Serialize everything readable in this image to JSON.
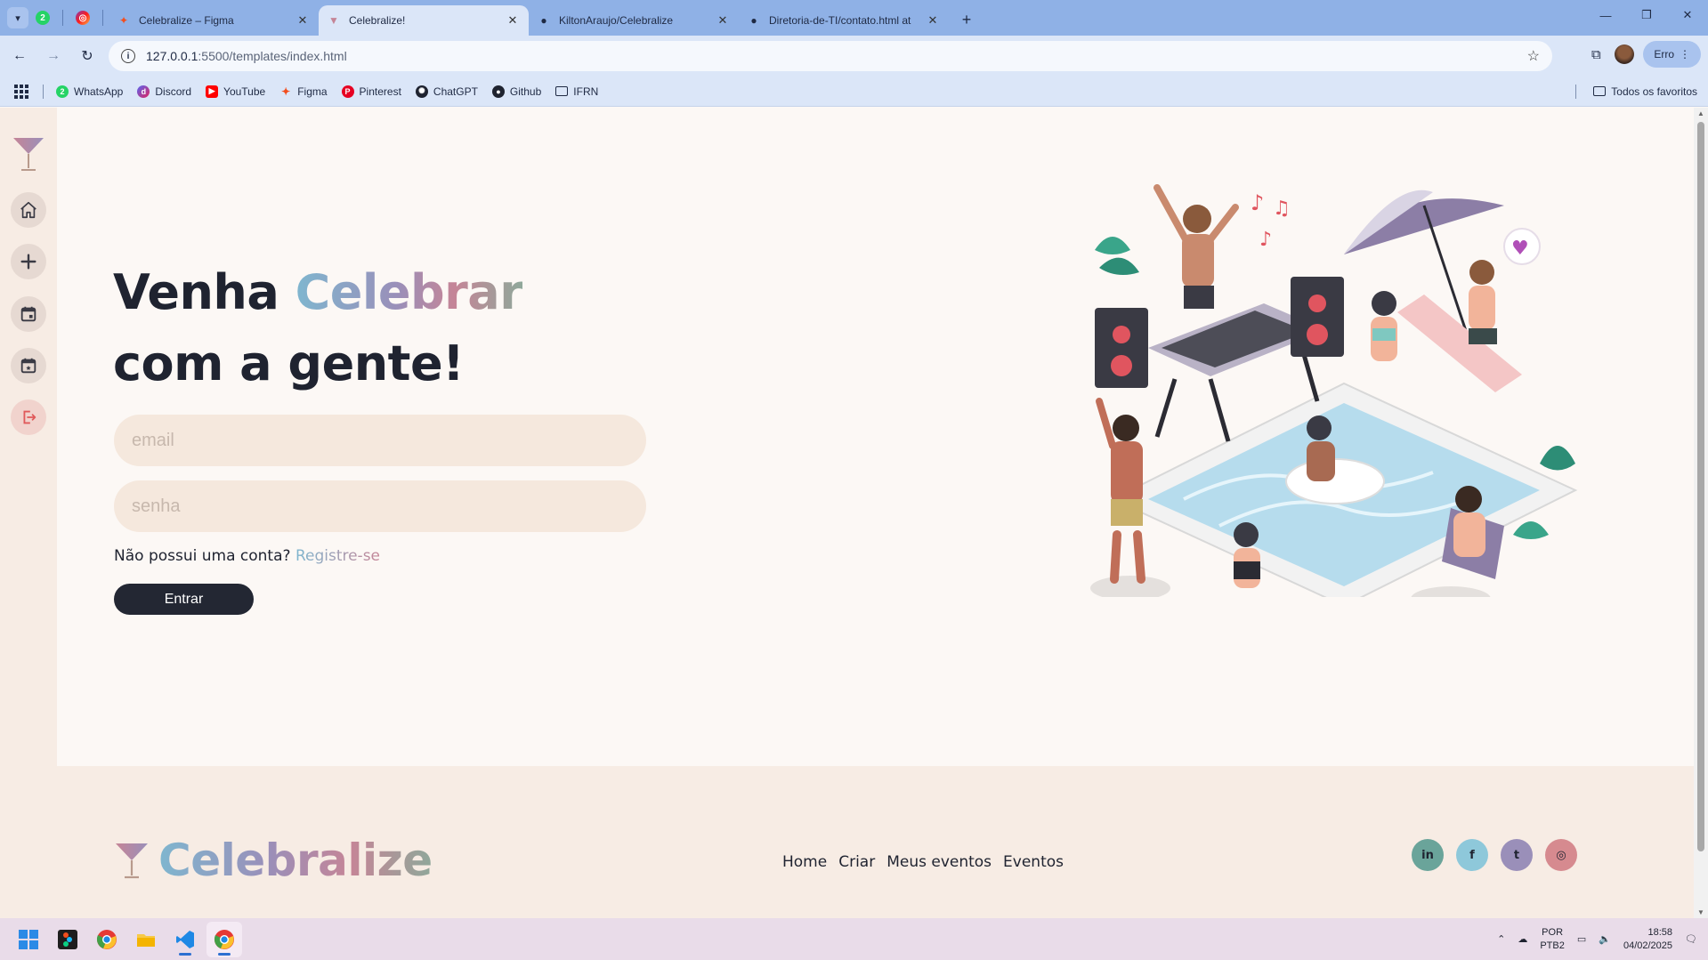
{
  "browser": {
    "tabs": [
      {
        "label": "Celebralize – Figma",
        "active": false,
        "favicon": "figma-icon"
      },
      {
        "label": "Celebralize!",
        "active": true,
        "favicon": "celebralize-icon"
      },
      {
        "label": "KiltonAraujo/Celebralize",
        "active": false,
        "favicon": "github-icon"
      },
      {
        "label": "Diretoria-de-TI/contato.html at",
        "active": false,
        "favicon": "github-icon"
      }
    ],
    "url_host": "127.0.0.1",
    "url_path": ":5500/templates/index.html",
    "error_label": "Erro",
    "bookmarks": [
      {
        "label": "WhatsApp",
        "icon": "whatsapp-icon",
        "color": "#25d366"
      },
      {
        "label": "Discord",
        "icon": "discord-icon",
        "color": "#5865f2"
      },
      {
        "label": "YouTube",
        "icon": "youtube-icon",
        "color": "#ff0000"
      },
      {
        "label": "Figma",
        "icon": "figma-icon",
        "color": "#f24e1e"
      },
      {
        "label": "Pinterest",
        "icon": "pinterest-icon",
        "color": "#e60023"
      },
      {
        "label": "ChatGPT",
        "icon": "chatgpt-icon",
        "color": "#1f2330"
      },
      {
        "label": "Github",
        "icon": "github-icon",
        "color": "#1f2330"
      },
      {
        "label": "IFRN",
        "icon": "folder-icon",
        "color": "#1f2330"
      }
    ],
    "all_bookmarks_label": "Todos os favoritos"
  },
  "page": {
    "hero_line1_prefix": "Venha ",
    "hero_line1_accent": "Celebrar",
    "hero_line2": "com a gente!",
    "email_placeholder": "email",
    "password_placeholder": "senha",
    "register_prompt": "Não possui uma conta? ",
    "register_link": "Registre-se",
    "submit_label": "Entrar",
    "sidebar_items": [
      "home-icon",
      "plus-icon",
      "calendar-icon",
      "calendar-check-icon",
      "logout-icon"
    ]
  },
  "footer": {
    "brand": "Celebralize",
    "nav": [
      "Home",
      "Criar",
      "Meus eventos",
      "Eventos"
    ],
    "socials": [
      {
        "name": "linkedin-icon",
        "glyph": "in",
        "color": "#6aa49a"
      },
      {
        "name": "facebook-icon",
        "glyph": "f",
        "color": "#8ec8da"
      },
      {
        "name": "twitter-icon",
        "glyph": "t",
        "color": "#9a8fb9"
      },
      {
        "name": "instagram-icon",
        "glyph": "◎",
        "color": "#d68a8f"
      }
    ]
  },
  "taskbar": {
    "lang_line1": "POR",
    "lang_line2": "PTB2",
    "time": "18:58",
    "date": "04/02/2025"
  },
  "colors": {
    "accent_blue": "#7fb6cf",
    "accent_purple": "#9a8fb9",
    "accent_pink": "#c58597",
    "dark": "#232733",
    "input_bg": "#f5e8dd"
  }
}
